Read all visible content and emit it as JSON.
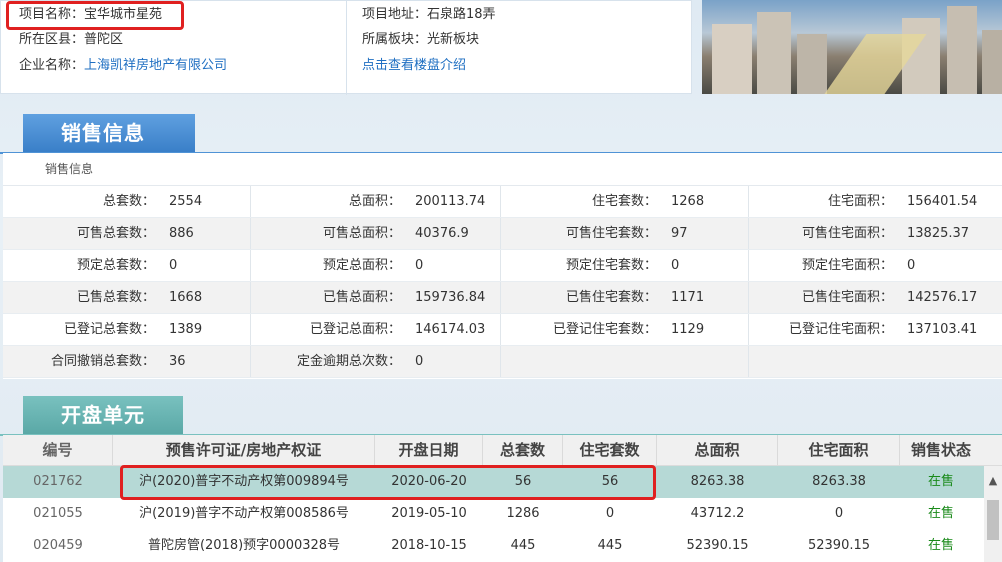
{
  "project": {
    "name_label": "项目名称：",
    "name": "宝华城市星苑",
    "district_label": "所在区县：",
    "district": "普陀区",
    "company_label": "企业名称：",
    "company": "上海凯祥房地产有限公司",
    "address_label": "项目地址：",
    "address": "石泉路18弄",
    "block_label": "所属板块：",
    "block": "光新板块",
    "intro_link": "点击查看楼盘介绍"
  },
  "sales_section": {
    "title": "销售信息",
    "caption": "销售信息",
    "rows": [
      [
        [
          "总套数：",
          "2554"
        ],
        [
          "总面积：",
          "200113.74"
        ],
        [
          "住宅套数：",
          "1268"
        ],
        [
          "住宅面积：",
          "156401.54"
        ]
      ],
      [
        [
          "可售总套数：",
          "886"
        ],
        [
          "可售总面积：",
          "40376.9"
        ],
        [
          "可售住宅套数：",
          "97"
        ],
        [
          "可售住宅面积：",
          "13825.37"
        ]
      ],
      [
        [
          "预定总套数：",
          "0"
        ],
        [
          "预定总面积：",
          "0"
        ],
        [
          "预定住宅套数：",
          "0"
        ],
        [
          "预定住宅面积：",
          "0"
        ]
      ],
      [
        [
          "已售总套数：",
          "1668"
        ],
        [
          "已售总面积：",
          "159736.84"
        ],
        [
          "已售住宅套数：",
          "1171"
        ],
        [
          "已售住宅面积：",
          "142576.17"
        ]
      ],
      [
        [
          "已登记总套数：",
          "1389"
        ],
        [
          "已登记总面积：",
          "146174.03"
        ],
        [
          "已登记住宅套数：",
          "1129"
        ],
        [
          "已登记住宅面积：",
          "137103.41"
        ]
      ],
      [
        [
          "合同撤销总套数：",
          "36"
        ],
        [
          "定金逾期总次数：",
          "0"
        ],
        [
          "",
          ""
        ],
        [
          "",
          ""
        ]
      ]
    ]
  },
  "units_section": {
    "title": "开盘单元",
    "headers": [
      "编号",
      "预售许可证/房地产权证",
      "开盘日期",
      "总套数",
      "住宅套数",
      "总面积",
      "住宅面积",
      "销售状态"
    ],
    "rows": [
      [
        "021762",
        "沪(2020)普字不动产权第009894号",
        "2020-06-20",
        "56",
        "56",
        "8263.38",
        "8263.38",
        "在售"
      ],
      [
        "021055",
        "沪(2019)普字不动产权第008586号",
        "2019-05-10",
        "1286",
        "0",
        "43712.2",
        "0",
        "在售"
      ],
      [
        "020459",
        "普陀房管(2018)预字0000328号",
        "2018-10-15",
        "445",
        "445",
        "52390.15",
        "52390.15",
        "在售"
      ]
    ],
    "selected_row": 0
  },
  "colors": {
    "sales_tab": "#3a7fc8",
    "units_tab": "#5aa8a6",
    "highlight": "#e02020",
    "selected_row": "#b6d9d6",
    "status": "#1a8a1a",
    "link": "#1f6fc2"
  },
  "icons": {
    "scroll_up": "chevron-up-icon"
  }
}
